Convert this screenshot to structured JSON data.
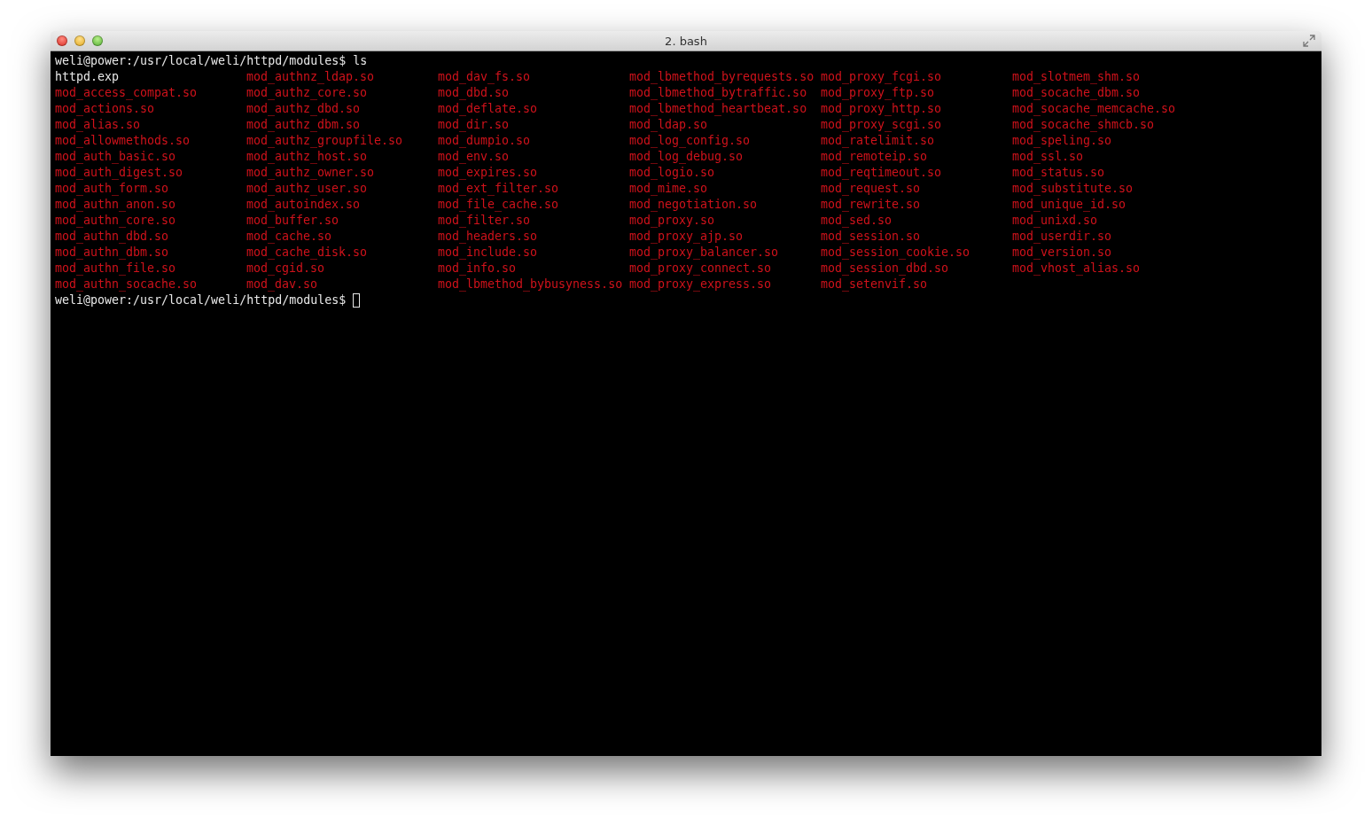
{
  "window": {
    "title": "2. bash"
  },
  "command_line": "weli@power:/usr/local/weli/httpd/modules$ ls",
  "listing": {
    "columns": [
      [
        {
          "name": "httpd.exp",
          "kind": "file"
        },
        {
          "name": "mod_access_compat.so",
          "kind": "library"
        },
        {
          "name": "mod_actions.so",
          "kind": "library"
        },
        {
          "name": "mod_alias.so",
          "kind": "library"
        },
        {
          "name": "mod_allowmethods.so",
          "kind": "library"
        },
        {
          "name": "mod_auth_basic.so",
          "kind": "library"
        },
        {
          "name": "mod_auth_digest.so",
          "kind": "library"
        },
        {
          "name": "mod_auth_form.so",
          "kind": "library"
        },
        {
          "name": "mod_authn_anon.so",
          "kind": "library"
        },
        {
          "name": "mod_authn_core.so",
          "kind": "library"
        },
        {
          "name": "mod_authn_dbd.so",
          "kind": "library"
        },
        {
          "name": "mod_authn_dbm.so",
          "kind": "library"
        },
        {
          "name": "mod_authn_file.so",
          "kind": "library"
        },
        {
          "name": "mod_authn_socache.so",
          "kind": "library"
        }
      ],
      [
        {
          "name": "mod_authnz_ldap.so",
          "kind": "library"
        },
        {
          "name": "mod_authz_core.so",
          "kind": "library"
        },
        {
          "name": "mod_authz_dbd.so",
          "kind": "library"
        },
        {
          "name": "mod_authz_dbm.so",
          "kind": "library"
        },
        {
          "name": "mod_authz_groupfile.so",
          "kind": "library"
        },
        {
          "name": "mod_authz_host.so",
          "kind": "library"
        },
        {
          "name": "mod_authz_owner.so",
          "kind": "library"
        },
        {
          "name": "mod_authz_user.so",
          "kind": "library"
        },
        {
          "name": "mod_autoindex.so",
          "kind": "library"
        },
        {
          "name": "mod_buffer.so",
          "kind": "library"
        },
        {
          "name": "mod_cache.so",
          "kind": "library"
        },
        {
          "name": "mod_cache_disk.so",
          "kind": "library"
        },
        {
          "name": "mod_cgid.so",
          "kind": "library"
        },
        {
          "name": "mod_dav.so",
          "kind": "library"
        }
      ],
      [
        {
          "name": "mod_dav_fs.so",
          "kind": "library"
        },
        {
          "name": "mod_dbd.so",
          "kind": "library"
        },
        {
          "name": "mod_deflate.so",
          "kind": "library"
        },
        {
          "name": "mod_dir.so",
          "kind": "library"
        },
        {
          "name": "mod_dumpio.so",
          "kind": "library"
        },
        {
          "name": "mod_env.so",
          "kind": "library"
        },
        {
          "name": "mod_expires.so",
          "kind": "library"
        },
        {
          "name": "mod_ext_filter.so",
          "kind": "library"
        },
        {
          "name": "mod_file_cache.so",
          "kind": "library"
        },
        {
          "name": "mod_filter.so",
          "kind": "library"
        },
        {
          "name": "mod_headers.so",
          "kind": "library"
        },
        {
          "name": "mod_include.so",
          "kind": "library"
        },
        {
          "name": "mod_info.so",
          "kind": "library"
        },
        {
          "name": "mod_lbmethod_bybusyness.so",
          "kind": "library"
        }
      ],
      [
        {
          "name": "mod_lbmethod_byrequests.so",
          "kind": "library"
        },
        {
          "name": "mod_lbmethod_bytraffic.so",
          "kind": "library"
        },
        {
          "name": "mod_lbmethod_heartbeat.so",
          "kind": "library"
        },
        {
          "name": "mod_ldap.so",
          "kind": "library"
        },
        {
          "name": "mod_log_config.so",
          "kind": "library"
        },
        {
          "name": "mod_log_debug.so",
          "kind": "library"
        },
        {
          "name": "mod_logio.so",
          "kind": "library"
        },
        {
          "name": "mod_mime.so",
          "kind": "library"
        },
        {
          "name": "mod_negotiation.so",
          "kind": "library"
        },
        {
          "name": "mod_proxy.so",
          "kind": "library"
        },
        {
          "name": "mod_proxy_ajp.so",
          "kind": "library"
        },
        {
          "name": "mod_proxy_balancer.so",
          "kind": "library"
        },
        {
          "name": "mod_proxy_connect.so",
          "kind": "library"
        },
        {
          "name": "mod_proxy_express.so",
          "kind": "library"
        }
      ],
      [
        {
          "name": "mod_proxy_fcgi.so",
          "kind": "library"
        },
        {
          "name": "mod_proxy_ftp.so",
          "kind": "library"
        },
        {
          "name": "mod_proxy_http.so",
          "kind": "library"
        },
        {
          "name": "mod_proxy_scgi.so",
          "kind": "library"
        },
        {
          "name": "mod_ratelimit.so",
          "kind": "library"
        },
        {
          "name": "mod_remoteip.so",
          "kind": "library"
        },
        {
          "name": "mod_reqtimeout.so",
          "kind": "library"
        },
        {
          "name": "mod_request.so",
          "kind": "library"
        },
        {
          "name": "mod_rewrite.so",
          "kind": "library"
        },
        {
          "name": "mod_sed.so",
          "kind": "library"
        },
        {
          "name": "mod_session.so",
          "kind": "library"
        },
        {
          "name": "mod_session_cookie.so",
          "kind": "library"
        },
        {
          "name": "mod_session_dbd.so",
          "kind": "library"
        },
        {
          "name": "mod_setenvif.so",
          "kind": "library"
        }
      ],
      [
        {
          "name": "mod_slotmem_shm.so",
          "kind": "library"
        },
        {
          "name": "mod_socache_dbm.so",
          "kind": "library"
        },
        {
          "name": "mod_socache_memcache.so",
          "kind": "library"
        },
        {
          "name": "mod_socache_shmcb.so",
          "kind": "library"
        },
        {
          "name": "mod_speling.so",
          "kind": "library"
        },
        {
          "name": "mod_ssl.so",
          "kind": "library"
        },
        {
          "name": "mod_status.so",
          "kind": "library"
        },
        {
          "name": "mod_substitute.so",
          "kind": "library"
        },
        {
          "name": "mod_unique_id.so",
          "kind": "library"
        },
        {
          "name": "mod_unixd.so",
          "kind": "library"
        },
        {
          "name": "mod_userdir.so",
          "kind": "library"
        },
        {
          "name": "mod_version.so",
          "kind": "library"
        },
        {
          "name": "mod_vhost_alias.so",
          "kind": "library"
        }
      ]
    ]
  },
  "prompt": "weli@power:/usr/local/weli/httpd/modules$"
}
